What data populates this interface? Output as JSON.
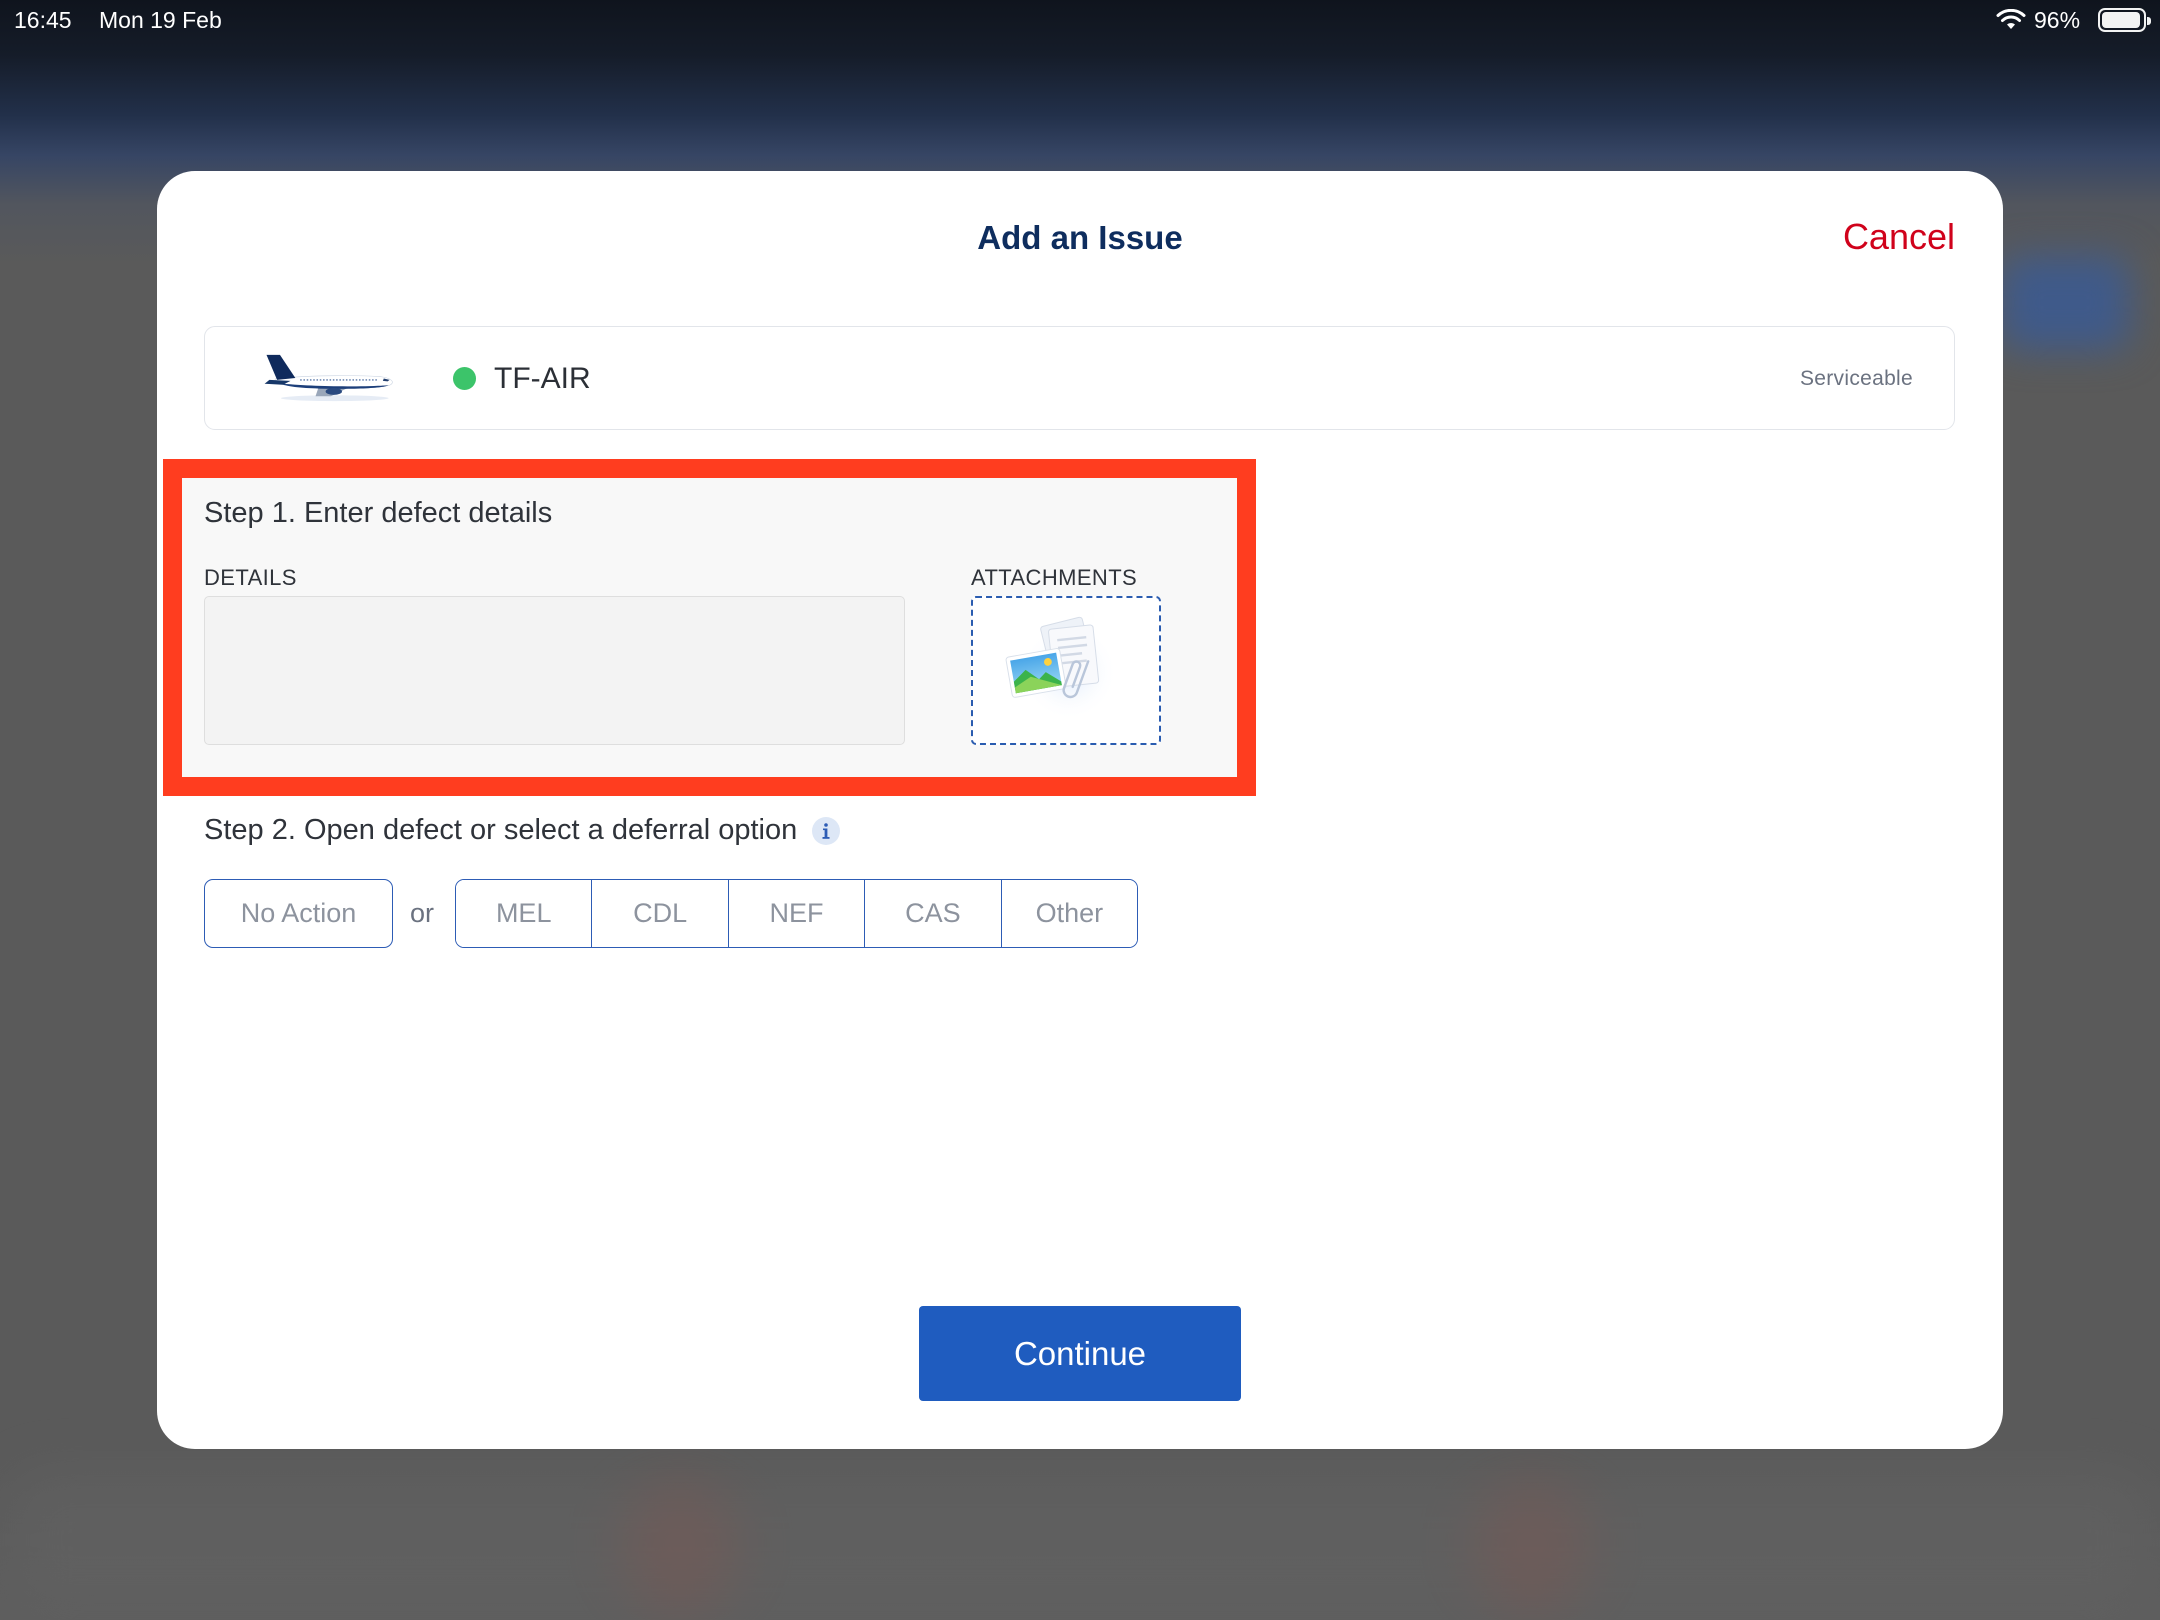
{
  "status_bar": {
    "time": "16:45",
    "date": "Mon 19 Feb",
    "battery": "96%",
    "icons": [
      "wifi-icon",
      "battery-icon"
    ]
  },
  "modal": {
    "title": "Add an Issue",
    "cancel_label": "Cancel"
  },
  "aircraft": {
    "registration": "TF-AIR",
    "status": "Serviceable",
    "status_color": "#3cc46a",
    "image": "airplane-image"
  },
  "step1": {
    "heading": "Step 1. Enter defect details",
    "details_label": "DETAILS",
    "details_value": "",
    "attachments_label": "ATTACHMENTS",
    "attachments_icon": "attachment-placeholder-image"
  },
  "step2": {
    "heading": "Step 2. Open defect or select a deferral option",
    "info_icon": "info-icon",
    "no_action_label": "No Action",
    "or_label": "or",
    "options": [
      "MEL",
      "CDL",
      "NEF",
      "CAS",
      "Other"
    ]
  },
  "continue_label": "Continue",
  "colors": {
    "accent": "#1f5cbf",
    "cancel": "#d0021b",
    "highlight": "#ff3d1f",
    "title": "#0e2d5e",
    "status": "#3cc46a"
  }
}
